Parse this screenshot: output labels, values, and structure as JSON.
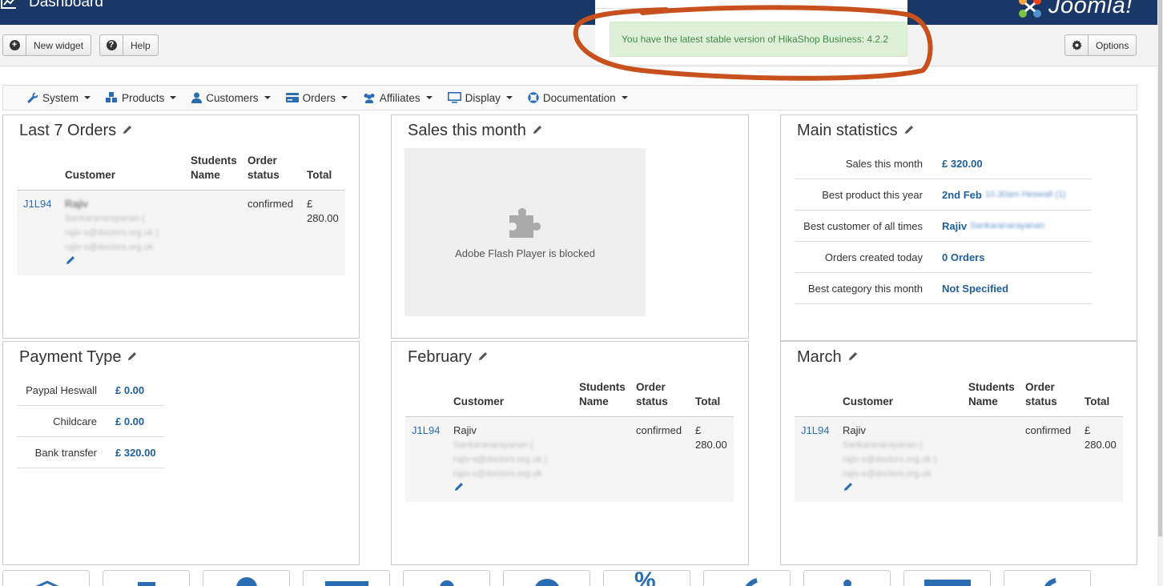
{
  "header": {
    "title": "Dashboard",
    "logo_text": "Joomla!"
  },
  "toolbar": {
    "new_widget": "New widget",
    "help": "Help",
    "options": "Options"
  },
  "notice": {
    "text": "You have the latest stable version of HikaShop Business: 4.2.2"
  },
  "menu": [
    {
      "label": "System",
      "icon": "wrench-icon"
    },
    {
      "label": "Products",
      "icon": "cubes-icon"
    },
    {
      "label": "Customers",
      "icon": "user-icon"
    },
    {
      "label": "Orders",
      "icon": "credit-card-icon"
    },
    {
      "label": "Affiliates",
      "icon": "users-icon"
    },
    {
      "label": "Display",
      "icon": "monitor-icon"
    },
    {
      "label": "Documentation",
      "icon": "life-ring-icon"
    }
  ],
  "order_columns": {
    "customer": "Customer",
    "students_name": "Students Name",
    "order_status": "Order status",
    "total": "Total"
  },
  "last7": {
    "title": "Last 7 Orders",
    "order": {
      "number": "J1L94",
      "customer_first": "Rajiv",
      "customer_last": "Sankaranarayanan (",
      "email_line": "rajiv-s@doctors.org.uk )",
      "email": "rajiv-s@doctors.org.uk",
      "status": "confirmed",
      "total_currency": "£",
      "total_value": "280.00"
    }
  },
  "sales_month": {
    "title": "Sales this month",
    "flash_message": "Adobe Flash Player is blocked"
  },
  "main_stats": {
    "title": "Main statistics",
    "rows": [
      {
        "label": "Sales this month",
        "value": "£ 320.00"
      },
      {
        "label": "Best product this year",
        "value": "2nd Feb",
        "blurred": "10.30am Heswall (1)"
      },
      {
        "label": "Best customer of all times",
        "value": "Rajiv",
        "blurred": "Sankaranarayanan"
      },
      {
        "label": "Orders created today",
        "value": "0 Orders"
      },
      {
        "label": "Best category this month",
        "value": "Not Specified"
      }
    ]
  },
  "payment": {
    "title": "Payment Type",
    "rows": [
      {
        "label": "Paypal Heswall",
        "value": "£ 0.00"
      },
      {
        "label": "Childcare",
        "value": "£ 0.00"
      },
      {
        "label": "Bank transfer",
        "value": "£ 320.00"
      }
    ]
  },
  "february": {
    "title": "February",
    "order": {
      "number": "J1L94",
      "customer_first": "Rajiv",
      "customer_last": "Sankaranarayanan (",
      "email_line": "rajiv-s@doctors.org.uk )",
      "email": "rajiv-s@doctors.org.uk",
      "status": "confirmed",
      "total_currency": "£",
      "total_value": "280.00"
    }
  },
  "march": {
    "title": "March",
    "order": {
      "number": "J1L94",
      "customer_first": "Rajiv",
      "customer_last": "Sankaranarayanan (",
      "email_line": "rajiv-s@doctors.org.uk )",
      "email": "rajiv-s@doctors.org.uk",
      "status": "confirmed",
      "total_currency": "£",
      "total_value": "280.00"
    }
  },
  "colors": {
    "header": "#1a3867",
    "link": "#2a6db3",
    "notice_bg": "#dff0d8",
    "annotation": "#c8501c"
  }
}
